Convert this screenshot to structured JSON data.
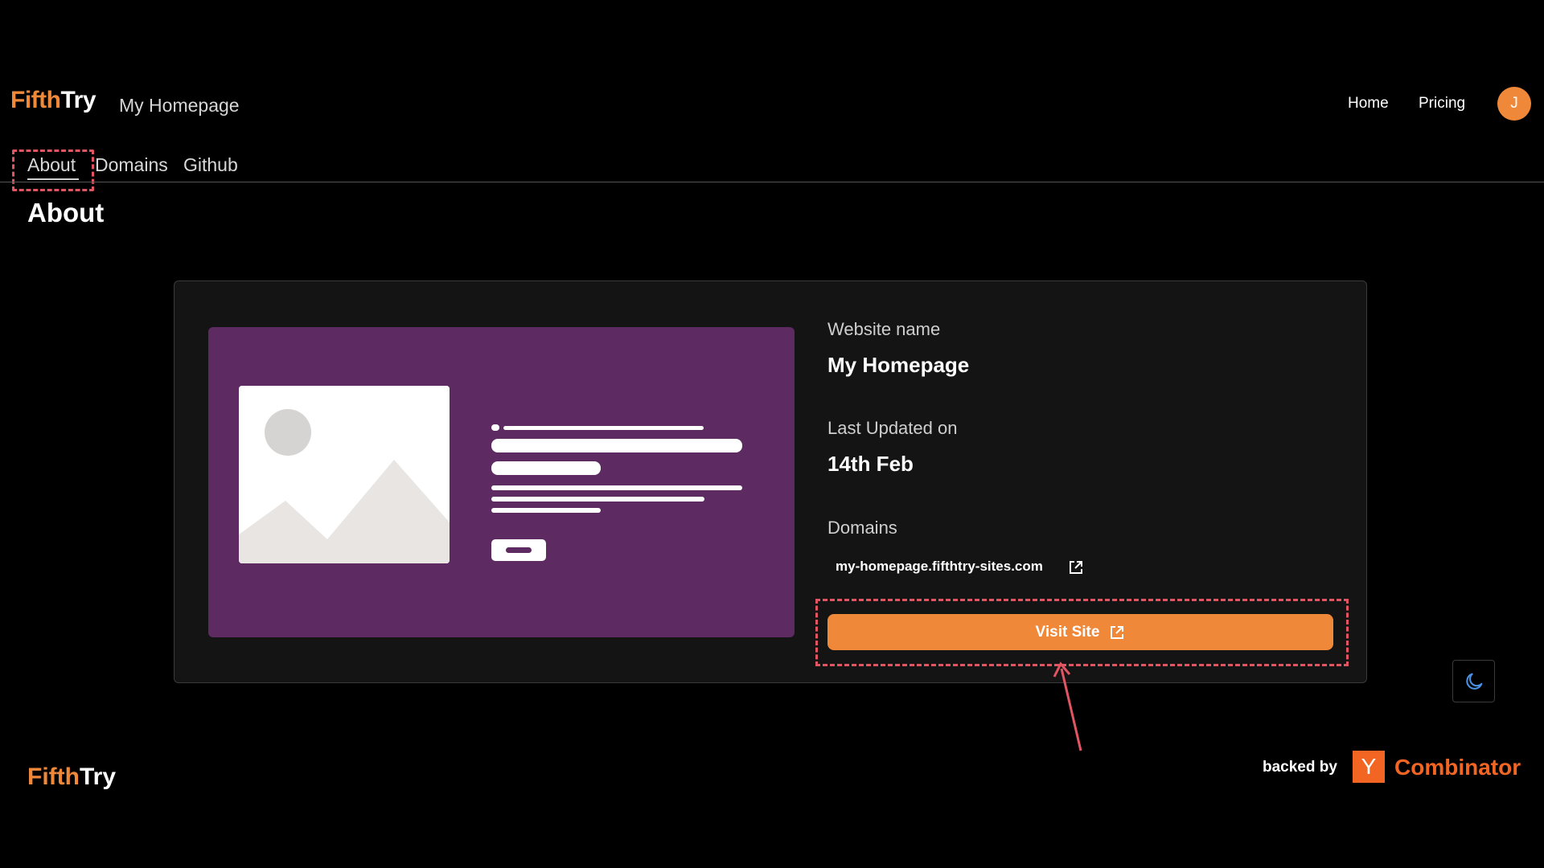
{
  "header": {
    "logo_part1": "Fifth",
    "logo_part2": "Try",
    "site_name": "My Homepage",
    "nav": {
      "home": "Home",
      "pricing": "Pricing"
    },
    "avatar_initial": "J"
  },
  "tabs": [
    {
      "label": "About",
      "active": true
    },
    {
      "label": "Domains",
      "active": false
    },
    {
      "label": "Github",
      "active": false
    }
  ],
  "page_title": "About",
  "card": {
    "website_name_label": "Website name",
    "website_name_value": "My Homepage",
    "last_updated_label": "Last Updated on",
    "last_updated_value": "14th Feb",
    "domains_label": "Domains",
    "domain": "my-homepage.fifthtry-sites.com",
    "visit_button": "Visit Site"
  },
  "footer": {
    "logo_part1": "Fifth",
    "logo_part2": "Try",
    "backed_by": "backed by",
    "yc_letter": "Y",
    "yc_name": "Combinator"
  },
  "colors": {
    "accent": "#f0883a",
    "preview_bg": "#5e2a62",
    "annotation": "#e05561",
    "yc_orange": "#f26522"
  },
  "icons": [
    "external-link-icon",
    "moon-icon",
    "image-placeholder-icon",
    "avatar"
  ]
}
